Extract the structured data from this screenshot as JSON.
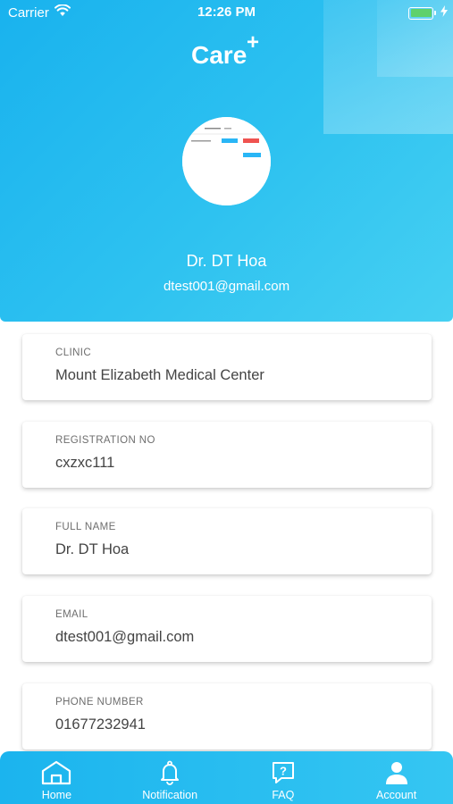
{
  "status_bar": {
    "carrier": "Carrier",
    "time": "12:26 PM",
    "battery_level": 1.0
  },
  "header": {
    "logo_text": "Care",
    "logo_mark": "+",
    "doctor_name": "Dr. DT Hoa",
    "doctor_email": "dtest001@gmail.com"
  },
  "fields": [
    {
      "label": "CLINIC",
      "value": "Mount Elizabeth Medical Center"
    },
    {
      "label": "REGISTRATION NO",
      "value": "cxzxc111"
    },
    {
      "label": "FULL NAME",
      "value": "Dr. DT Hoa"
    },
    {
      "label": "EMAIL",
      "value": "dtest001@gmail.com"
    },
    {
      "label": "PHONE NUMBER",
      "value": "01677232941"
    }
  ],
  "tabs": [
    {
      "label": "Home",
      "icon": "home-icon"
    },
    {
      "label": "Notification",
      "icon": "bell-icon"
    },
    {
      "label": "FAQ",
      "icon": "faq-icon"
    },
    {
      "label": "Account",
      "icon": "account-icon"
    }
  ],
  "colors": {
    "primary": "#19b2ee",
    "primary_light": "#46d0f2",
    "battery": "#5fd16b"
  }
}
